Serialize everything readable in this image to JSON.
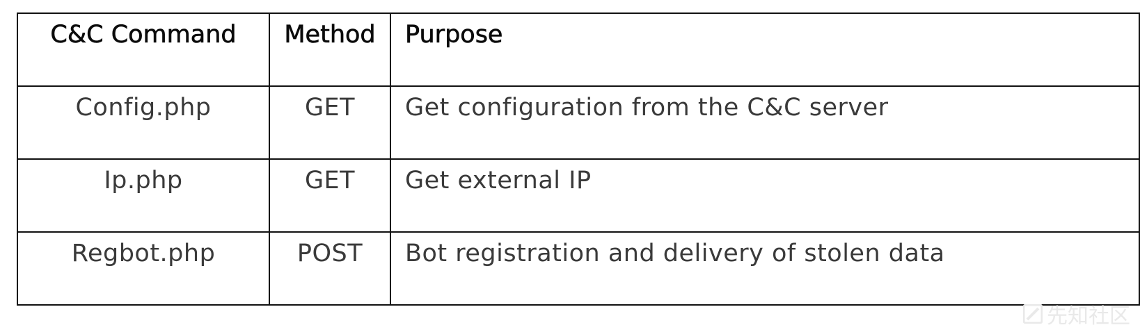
{
  "table": {
    "headers": [
      "C&C Command",
      "Method",
      "Purpose"
    ],
    "rows": [
      {
        "command": "Config.php",
        "method": "GET",
        "purpose": "Get configuration from the C&C server"
      },
      {
        "command": "Ip.php",
        "method": "GET",
        "purpose": "Get external IP"
      },
      {
        "command": "Regbot.php",
        "method": "POST",
        "purpose": "Bot registration and delivery of stolen data"
      }
    ]
  },
  "watermark": {
    "text": "先知社区",
    "color": "#e9e9e9"
  }
}
